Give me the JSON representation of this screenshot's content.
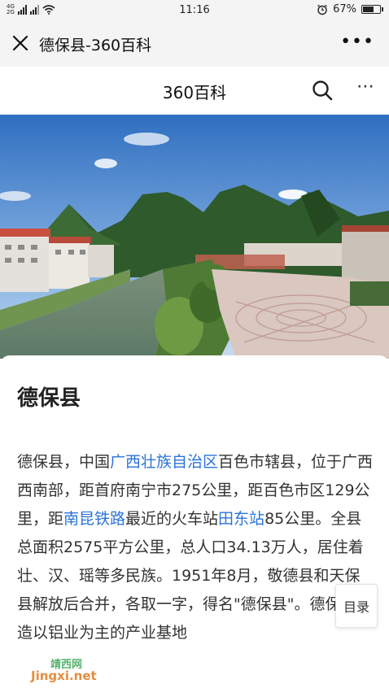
{
  "status_bar": {
    "signal_1": "4G",
    "signal_2": "2G",
    "time": "11:16",
    "battery": "67%",
    "battery_level": 0.67
  },
  "wechat_nav": {
    "title": "德保县-360百科",
    "close_icon": "close-icon",
    "more_icon": "more-icon",
    "more_label": "•••"
  },
  "site_header": {
    "title": "360百科",
    "search_icon": "search-icon",
    "more_label": "⋯"
  },
  "article": {
    "title": "德保县",
    "body": [
      {
        "text": "德保县，中国"
      },
      {
        "text": "广西壮族自治区",
        "link": true
      },
      {
        "text": "百色市辖县，位于广西西南部，距首府南宁市275公里，距百色市区129公里，距"
      },
      {
        "text": "南昆铁路",
        "link": true
      },
      {
        "text": "最近的火车站"
      },
      {
        "text": "田东站",
        "link": true
      },
      {
        "text": "85公里。全县总面积2575平方公里，总人口34.13万人，居住着壮、汉、瑶等多民族。1951年8月，敬德县和天保县解放后合并，各取一字，得名\"德保县\"。德保县打造以铝业为主的产业基地"
      }
    ]
  },
  "toc_button": {
    "label": "目录"
  },
  "watermark": {
    "line1": "靖西网",
    "line2": "Jingxi.net"
  },
  "colors": {
    "link": "#2a74d8",
    "nav_bg": "#f4f4f4"
  }
}
